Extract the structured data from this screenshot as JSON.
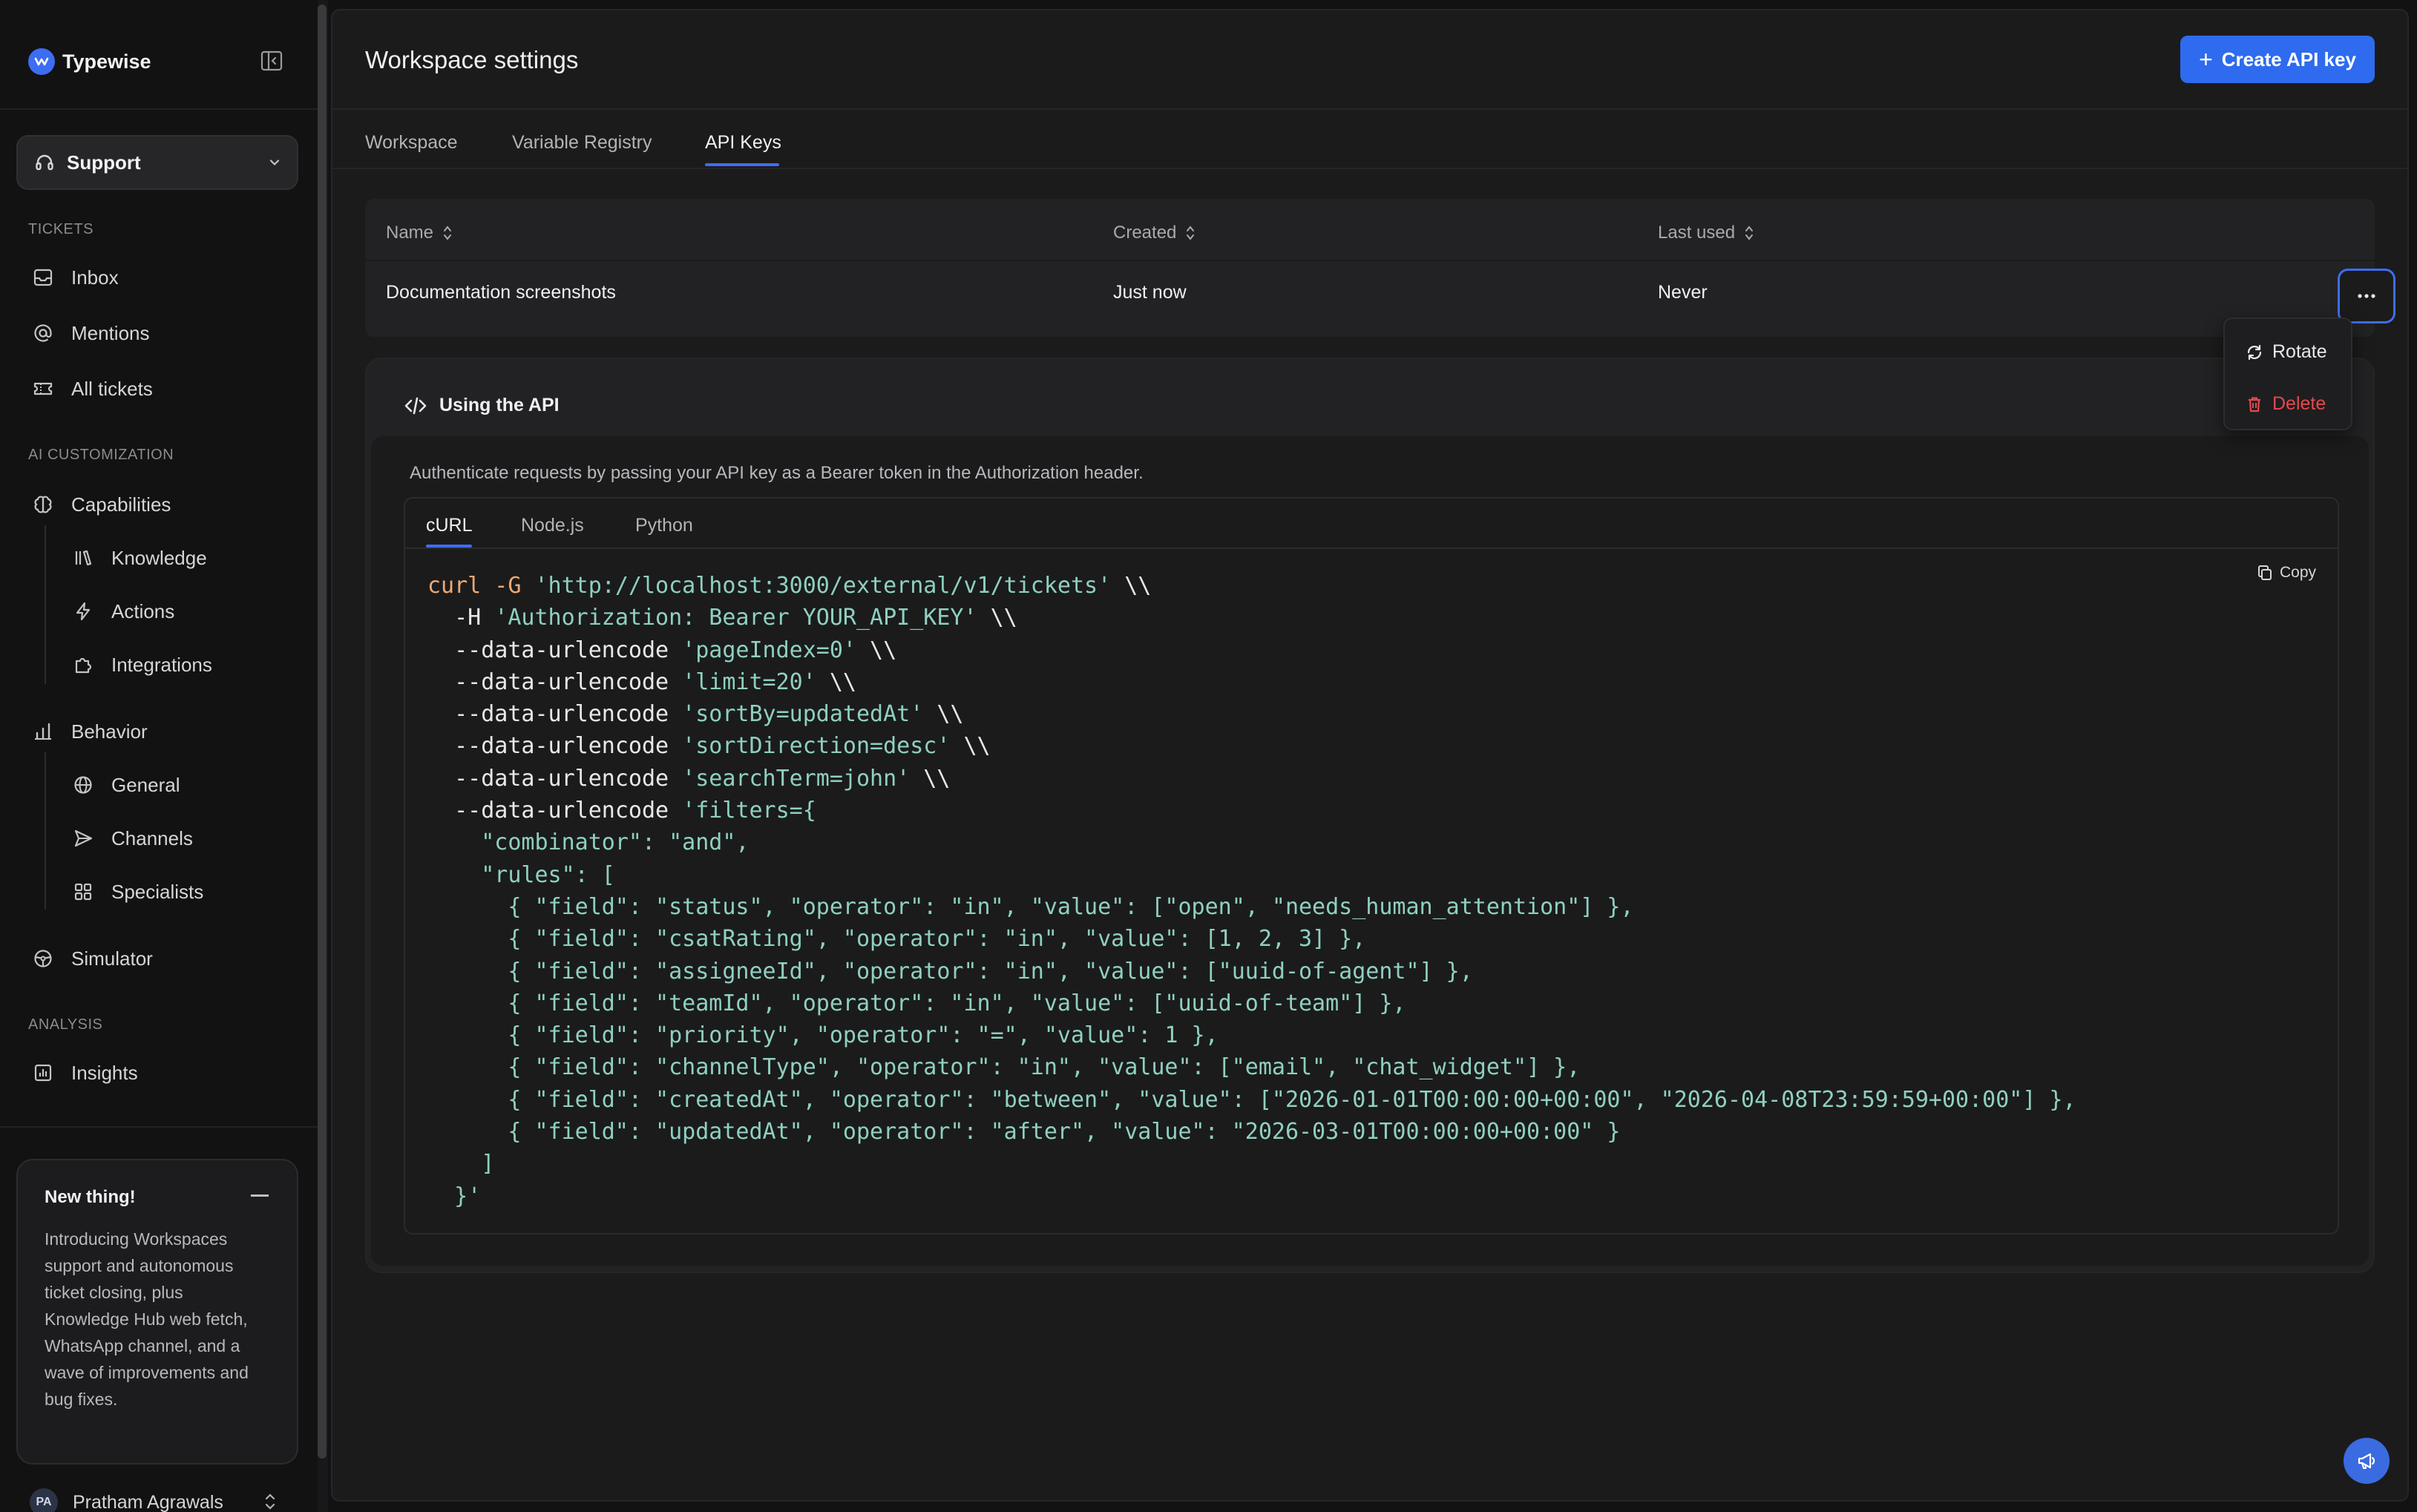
{
  "brand": {
    "name": "Typewise"
  },
  "workspace": {
    "label": "Support"
  },
  "sidebar": {
    "sections": [
      {
        "title": "TICKETS",
        "items": [
          {
            "label": "Inbox",
            "icon": "inbox-icon"
          },
          {
            "label": "Mentions",
            "icon": "at-sign-icon"
          },
          {
            "label": "All tickets",
            "icon": "ticket-icon"
          }
        ]
      },
      {
        "title": "AI CUSTOMIZATION",
        "items": [
          {
            "label": "Capabilities",
            "icon": "brain-icon"
          },
          {
            "label": "Knowledge",
            "icon": "library-icon"
          },
          {
            "label": "Actions",
            "icon": "bolt-icon"
          },
          {
            "label": "Integrations",
            "icon": "puzzle-icon"
          },
          {
            "label": "Behavior",
            "icon": "behavior-icon"
          },
          {
            "label": "General",
            "icon": "globe-icon"
          },
          {
            "label": "Channels",
            "icon": "send-icon"
          },
          {
            "label": "Specialists",
            "icon": "grid-icon"
          },
          {
            "label": "Simulator",
            "icon": "steering-wheel-icon"
          }
        ]
      },
      {
        "title": "ANALYSIS",
        "items": [
          {
            "label": "Insights",
            "icon": "bar-chart-icon"
          }
        ]
      }
    ]
  },
  "news": {
    "title": "New thing!",
    "body": "Introducing Workspaces support and autonomous ticket closing, plus Knowledge Hub web fetch, WhatsApp channel, and a wave of improvements and bug fixes."
  },
  "user": {
    "initials": "PA",
    "name": "Pratham Agrawals"
  },
  "header": {
    "title": "Workspace settings",
    "create_button": "Create API key"
  },
  "tabs": [
    {
      "label": "Workspace"
    },
    {
      "label": "Variable Registry"
    },
    {
      "label": "API Keys",
      "active": true
    }
  ],
  "table": {
    "columns": [
      "Name",
      "Created",
      "Last used"
    ],
    "rows": [
      {
        "name": "Documentation screenshots",
        "created": "Just now",
        "last_used": "Never"
      }
    ]
  },
  "row_menu": {
    "rotate": "Rotate",
    "delete": "Delete"
  },
  "api": {
    "title": "Using the API",
    "description": "Authenticate requests by passing your API key as a Bearer token in the Authorization header.",
    "code_tabs": [
      "cURL",
      "Node.js",
      "Python"
    ],
    "copy_label": "Copy",
    "code_lines": [
      "curl -G 'http://localhost:3000/external/v1/tickets' \\\\",
      "  -H 'Authorization: Bearer YOUR_API_KEY' \\\\",
      "  --data-urlencode 'pageIndex=0' \\\\",
      "  --data-urlencode 'limit=20' \\\\",
      "  --data-urlencode 'sortBy=updatedAt' \\\\",
      "  --data-urlencode 'sortDirection=desc' \\\\",
      "  --data-urlencode 'searchTerm=john' \\\\",
      "  --data-urlencode 'filters={",
      "    \"combinator\": \"and\",",
      "    \"rules\": [",
      "      { \"field\": \"status\", \"operator\": \"in\", \"value\": [\"open\", \"needs_human_attention\"] },",
      "      { \"field\": \"csatRating\", \"operator\": \"in\", \"value\": [1, 2, 3] },",
      "      { \"field\": \"assigneeId\", \"operator\": \"in\", \"value\": [\"uuid-of-agent\"] },",
      "      { \"field\": \"teamId\", \"operator\": \"in\", \"value\": [\"uuid-of-team\"] },",
      "      { \"field\": \"priority\", \"operator\": \"=\", \"value\": 1 },",
      "      { \"field\": \"channelType\", \"operator\": \"in\", \"value\": [\"email\", \"chat_widget\"] },",
      "      { \"field\": \"createdAt\", \"operator\": \"between\", \"value\": [\"2026-01-01T00:00:00+00:00\", \"2026-04-08T23:59:59+00:00\"] },",
      "      { \"field\": \"updatedAt\", \"operator\": \"after\", \"value\": \"2026-03-01T00:00:00+00:00\" }",
      "    ]",
      "  }'"
    ]
  },
  "colors": {
    "accent": "#3d6df2",
    "danger": "#e5484d",
    "code_command": "#f0a870",
    "code_string": "#8fd0c0"
  }
}
